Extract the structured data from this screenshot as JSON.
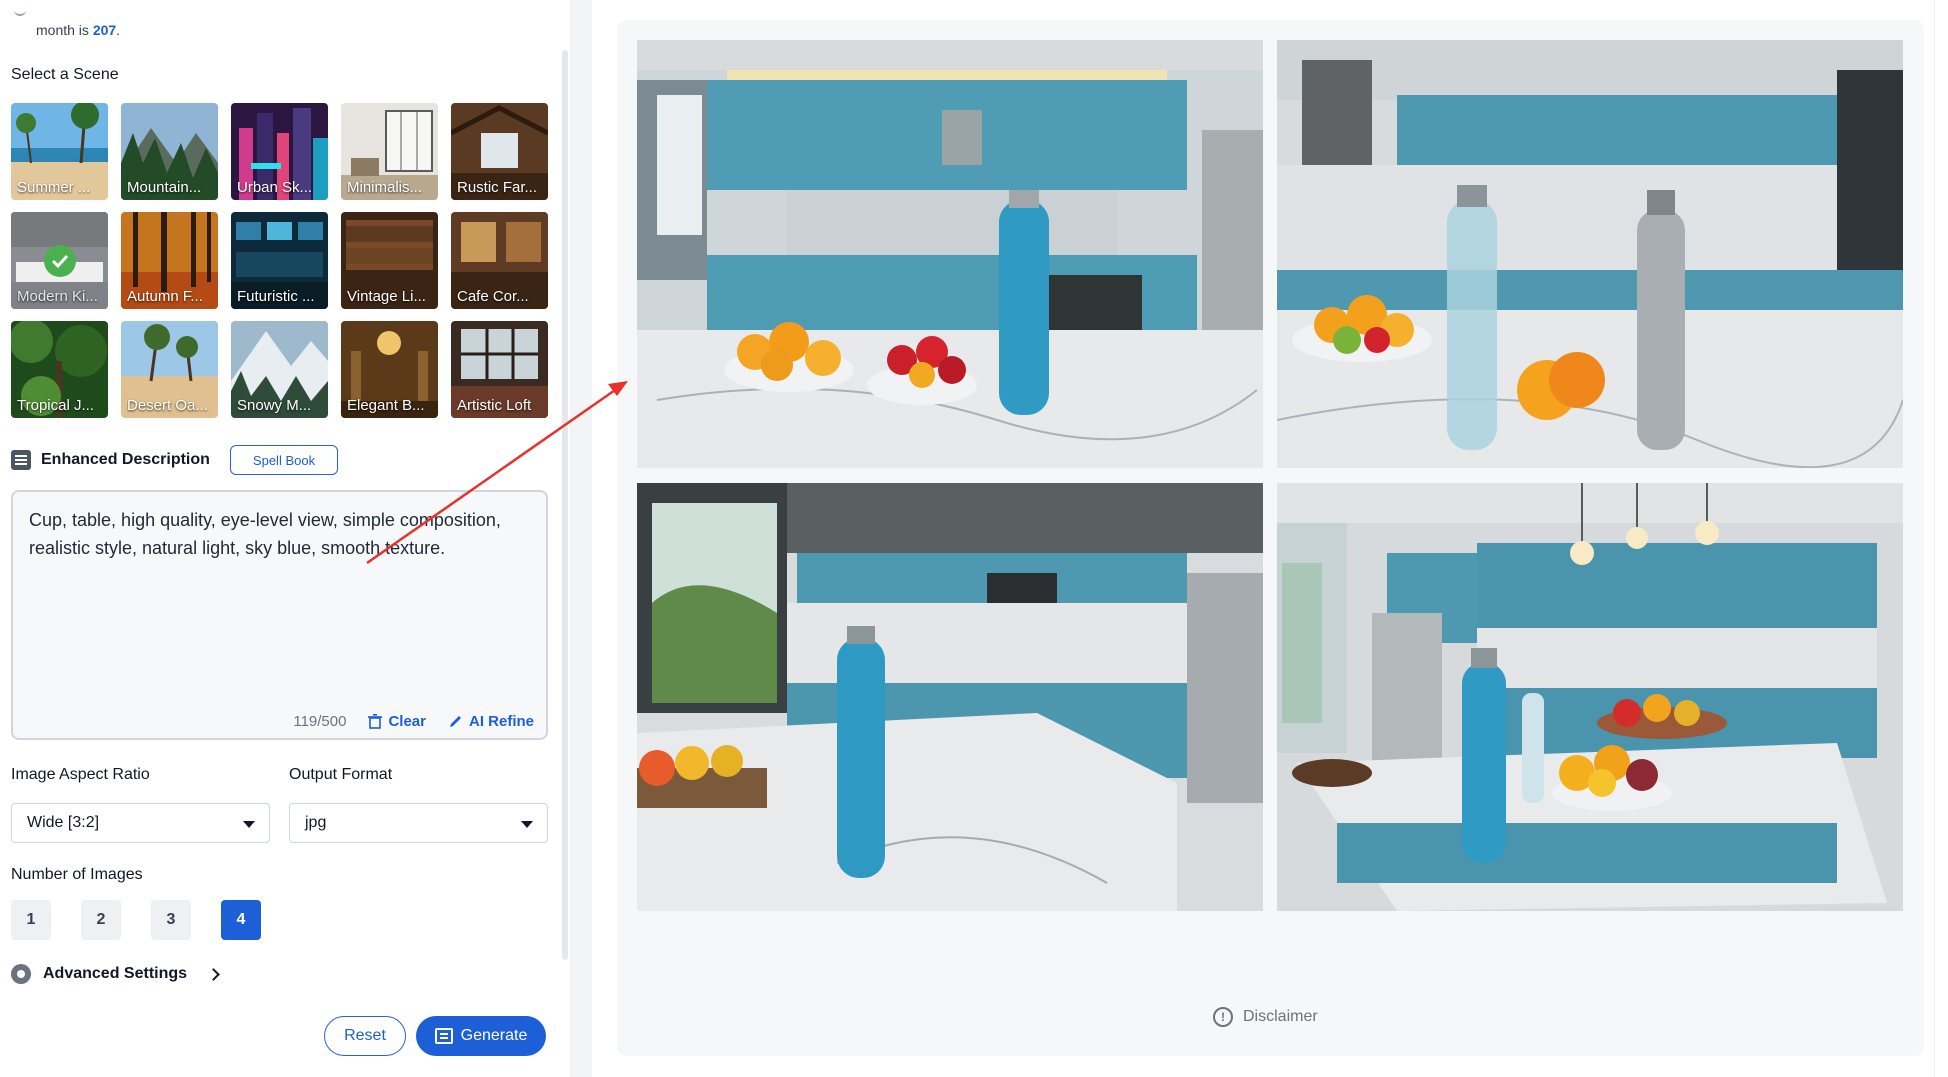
{
  "credit": {
    "prefix": "month is ",
    "value": "207",
    "suffix": "."
  },
  "scene_section": {
    "title": "Select a Scene"
  },
  "scenes": [
    {
      "label": "Summer ...",
      "selected": false
    },
    {
      "label": "Mountain...",
      "selected": false
    },
    {
      "label": "Urban Sk...",
      "selected": false
    },
    {
      "label": "Minimalis...",
      "selected": false
    },
    {
      "label": "Rustic Far...",
      "selected": false
    },
    {
      "label": "Modern Ki...",
      "selected": true
    },
    {
      "label": "Autumn F...",
      "selected": false
    },
    {
      "label": "Futuristic ...",
      "selected": false
    },
    {
      "label": "Vintage Li...",
      "selected": false
    },
    {
      "label": "Cafe Cor...",
      "selected": false
    },
    {
      "label": "Tropical J...",
      "selected": false
    },
    {
      "label": "Desert Oa...",
      "selected": false
    },
    {
      "label": "Snowy M...",
      "selected": false
    },
    {
      "label": "Elegant B...",
      "selected": false
    },
    {
      "label": "Artistic Loft",
      "selected": false
    }
  ],
  "enhanced": {
    "title": "Enhanced Description",
    "spell_book": "Spell Book",
    "text": "Cup, table, high quality, eye-level view, simple composition, realistic style, natural light, sky blue, smooth texture.",
    "counter": "119/500",
    "clear": "Clear",
    "ai_refine": "AI Refine"
  },
  "aspect": {
    "label": "Image Aspect Ratio",
    "value": "Wide [3:2]"
  },
  "format": {
    "label": "Output Format",
    "value": "jpg"
  },
  "num_images": {
    "label": "Number of Images",
    "options": [
      "1",
      "2",
      "3",
      "4"
    ],
    "selected": "4"
  },
  "advanced": {
    "label": "Advanced Settings"
  },
  "buttons": {
    "reset": "Reset",
    "generate": "Generate"
  },
  "results": {
    "count": 4
  },
  "disclaimer": "Disclaimer",
  "colors": {
    "accent": "#1d5fd6",
    "check": "#4caf50",
    "annotation_arrow": "#e8312b"
  }
}
